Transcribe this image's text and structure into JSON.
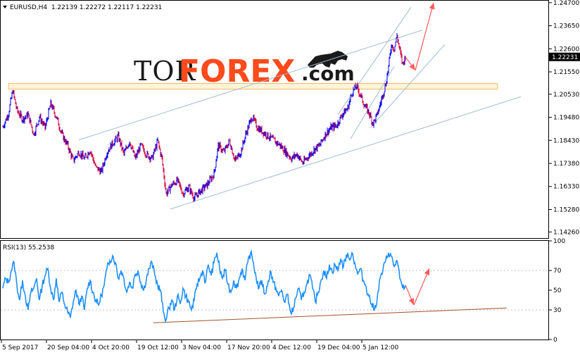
{
  "chart_data": [
    {
      "type": "candlestick",
      "title": "EURUSD,H4  1.22139 1.22272 1.22117 1.22231",
      "symbol_title": "EURUSD,H4",
      "ohlc": [
        "1.22139",
        "1.22272",
        "1.22117",
        "1.22231"
      ],
      "current_price": 1.22231,
      "current_price_label": "1.22231",
      "ylim": [
        1.1398,
        1.2479
      ],
      "y_ticks": [
        "1.24700",
        "1.23650",
        "1.22600",
        "1.21550",
        "1.20530",
        "1.19480",
        "1.18430",
        "1.17380",
        "1.16330",
        "1.15280",
        "1.14260"
      ],
      "x_ticks": [
        "5 Sep 2017",
        "20 Sep 04:00",
        "4 Oct 20:00",
        "19 Oct 12:00",
        "3 Nov 04:00",
        "17 Nov 20:00",
        "4 Dec 12:00",
        "19 Dec 04:00",
        "5 Jan 12:00"
      ],
      "colors": {
        "bull": "#0000ff",
        "bear": "#d4003c",
        "channel": "#9fbcd6",
        "arrow": "#ff5a5a",
        "zone_fill": "#fff4d6",
        "zone_stroke": "#f5b96a"
      },
      "resistance_zone": [
        1.2076,
        1.2102
      ],
      "price_path": [
        [
          0,
          1.1905
        ],
        [
          8,
          1.1965
        ],
        [
          14,
          1.207
        ],
        [
          20,
          1.198
        ],
        [
          28,
          1.194
        ],
        [
          36,
          1.196
        ],
        [
          44,
          1.187
        ],
        [
          52,
          1.195
        ],
        [
          60,
          1.19
        ],
        [
          68,
          1.201
        ],
        [
          76,
          1.195
        ],
        [
          84,
          1.187
        ],
        [
          92,
          1.182
        ],
        [
          100,
          1.175
        ],
        [
          108,
          1.179
        ],
        [
          116,
          1.176
        ],
        [
          124,
          1.18
        ],
        [
          132,
          1.172
        ],
        [
          140,
          1.17
        ],
        [
          148,
          1.179
        ],
        [
          156,
          1.183
        ],
        [
          164,
          1.186
        ],
        [
          172,
          1.178
        ],
        [
          180,
          1.184
        ],
        [
          188,
          1.176
        ],
        [
          196,
          1.182
        ],
        [
          204,
          1.178
        ],
        [
          212,
          1.176
        ],
        [
          220,
          1.184
        ],
        [
          226,
          1.176
        ],
        [
          232,
          1.16
        ],
        [
          240,
          1.164
        ],
        [
          248,
          1.166
        ],
        [
          256,
          1.16
        ],
        [
          264,
          1.163
        ],
        [
          272,
          1.158
        ],
        [
          280,
          1.161
        ],
        [
          290,
          1.164
        ],
        [
          300,
          1.169
        ],
        [
          306,
          1.182
        ],
        [
          314,
          1.179
        ],
        [
          322,
          1.184
        ],
        [
          330,
          1.175
        ],
        [
          338,
          1.179
        ],
        [
          346,
          1.188
        ],
        [
          354,
          1.195
        ],
        [
          362,
          1.19
        ],
        [
          370,
          1.188
        ],
        [
          378,
          1.186
        ],
        [
          386,
          1.184
        ],
        [
          394,
          1.182
        ],
        [
          402,
          1.179
        ],
        [
          410,
          1.176
        ],
        [
          418,
          1.178
        ],
        [
          426,
          1.174
        ],
        [
          434,
          1.177
        ],
        [
          442,
          1.18
        ],
        [
          450,
          1.182
        ],
        [
          458,
          1.187
        ],
        [
          466,
          1.19
        ],
        [
          474,
          1.191
        ],
        [
          482,
          1.196
        ],
        [
          490,
          1.199
        ],
        [
          496,
          1.206
        ],
        [
          502,
          1.209
        ],
        [
          508,
          1.205
        ],
        [
          514,
          1.2
        ],
        [
          520,
          1.197
        ],
        [
          526,
          1.192
        ],
        [
          532,
          1.196
        ],
        [
          538,
          1.203
        ],
        [
          544,
          1.21
        ],
        [
          548,
          1.218
        ],
        [
          552,
          1.228
        ],
        [
          556,
          1.226
        ],
        [
          560,
          1.232
        ],
        [
          564,
          1.225
        ],
        [
          568,
          1.219
        ],
        [
          572,
          1.2223
        ]
      ],
      "channel_lines": [
        [
          [
            108,
            1.1845
          ],
          [
            596,
            1.2345
          ]
        ],
        [
          [
            476,
            1.196
          ],
          [
            580,
            1.245
          ]
        ],
        [
          [
            522,
            1.19
          ],
          [
            628,
            1.228
          ]
        ],
        [
          [
            238,
            1.153
          ],
          [
            736,
            1.2042
          ]
        ],
        [
          [
            494,
            1.185
          ],
          [
            556,
            1.218
          ]
        ]
      ],
      "forecast_arrows": [
        [
          [
            572,
            1.2223
          ],
          [
            586,
            1.2162
          ]
        ],
        [
          [
            586,
            1.2162
          ],
          [
            612,
            1.247
          ]
        ]
      ]
    },
    {
      "type": "line",
      "title": "RSI(13) 55.2538",
      "ylim": [
        0,
        100
      ],
      "y_ticks": [
        "100",
        "70",
        "50",
        "30",
        "0"
      ],
      "levels": [
        30,
        70
      ],
      "colors": {
        "line": "#1e90ff",
        "support": "#a0522d",
        "arrow": "#ff5a5a"
      },
      "values": [
        [
          0,
          52
        ],
        [
          4,
          62
        ],
        [
          8,
          58
        ],
        [
          12,
          70
        ],
        [
          16,
          78
        ],
        [
          20,
          55
        ],
        [
          24,
          40
        ],
        [
          28,
          60
        ],
        [
          32,
          44
        ],
        [
          36,
          30
        ],
        [
          40,
          48
        ],
        [
          44,
          52
        ],
        [
          48,
          62
        ],
        [
          52,
          40
        ],
        [
          56,
          55
        ],
        [
          60,
          65
        ],
        [
          64,
          72
        ],
        [
          68,
          52
        ],
        [
          72,
          40
        ],
        [
          76,
          62
        ],
        [
          80,
          38
        ],
        [
          84,
          48
        ],
        [
          88,
          35
        ],
        [
          92,
          28
        ],
        [
          96,
          22
        ],
        [
          100,
          38
        ],
        [
          104,
          50
        ],
        [
          108,
          36
        ],
        [
          112,
          44
        ],
        [
          116,
          30
        ],
        [
          120,
          52
        ],
        [
          124,
          60
        ],
        [
          128,
          48
        ],
        [
          132,
          40
        ],
        [
          136,
          35
        ],
        [
          140,
          45
        ],
        [
          144,
          55
        ],
        [
          148,
          72
        ],
        [
          152,
          80
        ],
        [
          156,
          85
        ],
        [
          160,
          78
        ],
        [
          164,
          62
        ],
        [
          168,
          70
        ],
        [
          172,
          62
        ],
        [
          176,
          48
        ],
        [
          180,
          58
        ],
        [
          184,
          52
        ],
        [
          188,
          66
        ],
        [
          192,
          70
        ],
        [
          196,
          58
        ],
        [
          200,
          50
        ],
        [
          204,
          62
        ],
        [
          208,
          72
        ],
        [
          212,
          78
        ],
        [
          216,
          65
        ],
        [
          220,
          55
        ],
        [
          224,
          50
        ],
        [
          228,
          28
        ],
        [
          232,
          20
        ],
        [
          236,
          32
        ],
        [
          240,
          40
        ],
        [
          244,
          30
        ],
        [
          248,
          44
        ],
        [
          252,
          36
        ],
        [
          256,
          52
        ],
        [
          260,
          44
        ],
        [
          264,
          38
        ],
        [
          268,
          30
        ],
        [
          272,
          40
        ],
        [
          276,
          56
        ],
        [
          280,
          62
        ],
        [
          284,
          70
        ],
        [
          288,
          58
        ],
        [
          292,
          76
        ],
        [
          296,
          65
        ],
        [
          300,
          78
        ],
        [
          304,
          88
        ],
        [
          308,
          72
        ],
        [
          312,
          62
        ],
        [
          316,
          70
        ],
        [
          320,
          56
        ],
        [
          324,
          48
        ],
        [
          328,
          60
        ],
        [
          332,
          52
        ],
        [
          336,
          62
        ],
        [
          340,
          72
        ],
        [
          344,
          60
        ],
        [
          348,
          78
        ],
        [
          352,
          88
        ],
        [
          356,
          78
        ],
        [
          360,
          62
        ],
        [
          364,
          52
        ],
        [
          368,
          60
        ],
        [
          372,
          46
        ],
        [
          376,
          54
        ],
        [
          380,
          70
        ],
        [
          384,
          58
        ],
        [
          388,
          52
        ],
        [
          392,
          44
        ],
        [
          396,
          50
        ],
        [
          400,
          38
        ],
        [
          404,
          46
        ],
        [
          408,
          30
        ],
        [
          412,
          28
        ],
        [
          416,
          42
        ],
        [
          420,
          52
        ],
        [
          424,
          40
        ],
        [
          428,
          48
        ],
        [
          432,
          56
        ],
        [
          436,
          66
        ],
        [
          440,
          52
        ],
        [
          444,
          38
        ],
        [
          448,
          48
        ],
        [
          452,
          60
        ],
        [
          456,
          70
        ],
        [
          460,
          62
        ],
        [
          464,
          76
        ],
        [
          468,
          68
        ],
        [
          472,
          76
        ],
        [
          476,
          70
        ],
        [
          480,
          82
        ],
        [
          484,
          74
        ],
        [
          488,
          86
        ],
        [
          492,
          82
        ],
        [
          496,
          88
        ],
        [
          500,
          78
        ],
        [
          504,
          66
        ],
        [
          508,
          72
        ],
        [
          512,
          60
        ],
        [
          516,
          54
        ],
        [
          520,
          44
        ],
        [
          524,
          36
        ],
        [
          528,
          30
        ],
        [
          532,
          42
        ],
        [
          536,
          62
        ],
        [
          540,
          70
        ],
        [
          544,
          80
        ],
        [
          548,
          88
        ],
        [
          552,
          84
        ],
        [
          556,
          74
        ],
        [
          560,
          80
        ],
        [
          564,
          62
        ],
        [
          568,
          52
        ],
        [
          572,
          55
        ]
      ],
      "support_line": [
        [
          214,
          17
        ],
        [
          716,
          32
        ]
      ],
      "forecast_arrows": [
        [
          [
            572,
            55
          ],
          [
            584,
            35
          ]
        ],
        [
          [
            584,
            35
          ],
          [
            606,
            72
          ]
        ]
      ]
    }
  ],
  "watermark": {
    "tor": "TOR",
    "forex": "FOREX",
    "com": ".com",
    "icon": "bull-icon"
  }
}
